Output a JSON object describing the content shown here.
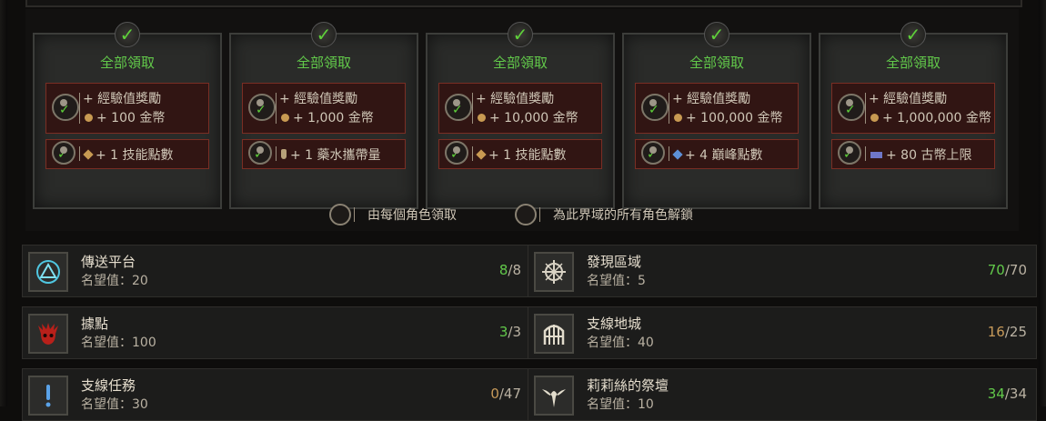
{
  "rewards": {
    "tiers": [
      {
        "claim": "全部領取",
        "line1": "+ 經驗值獎勵",
        "line2": "+ 100 金幣",
        "line3": "+ 1 技能點數",
        "line3_icon": "skill-point-icon"
      },
      {
        "claim": "全部領取",
        "line1": "+ 經驗值獎勵",
        "line2": "+ 1,000 金幣",
        "line3": "+ 1 藥水攜帶量",
        "line3_icon": "potion-icon"
      },
      {
        "claim": "全部領取",
        "line1": "+ 經驗值獎勵",
        "line2": "+ 10,000 金幣",
        "line3": "+ 1 技能點數",
        "line3_icon": "skill-point-icon"
      },
      {
        "claim": "全部領取",
        "line1": "+ 經驗值獎勵",
        "line2": "+ 100,000 金幣",
        "line3": "+ 4 巔峰點數",
        "line3_icon": "paragon-icon"
      },
      {
        "claim": "全部領取",
        "line1": "+ 經驗值獎勵",
        "line2": "+ 1,000,000 金幣",
        "line3": "+ 80 古幣上限",
        "line3_icon": "obol-icon"
      }
    ],
    "legend": {
      "per_character": "由每個角色領取",
      "all_characters": "為此界域的所有角色解鎖"
    }
  },
  "entries": {
    "waypoints": {
      "title": "傳送平台",
      "sub": "名望值：20",
      "done": "8",
      "total": "/8",
      "icon": "waypoint-icon"
    },
    "areas": {
      "title": "發現區域",
      "sub": "名望值：5",
      "done": "70",
      "total": "/70",
      "icon": "compass-icon"
    },
    "strongholds": {
      "title": "據點",
      "sub": "名望值：100",
      "done": "3",
      "total": "/3",
      "icon": "demon-skull-icon"
    },
    "dungeons": {
      "title": "支線地城",
      "sub": "名望值：40",
      "done": "16",
      "total": "/25",
      "icon": "gate-icon"
    },
    "side_quests": {
      "title": "支線任務",
      "sub": "名望值：30",
      "done": "0",
      "total": "/47",
      "icon": "exclamation-icon"
    },
    "altars": {
      "title": "莉莉絲的祭壇",
      "sub": "名望值：10",
      "done": "34",
      "total": "/34",
      "icon": "lilith-altar-icon"
    }
  },
  "colors": {
    "claimed": "#62c94a",
    "partial": "#c79a5a",
    "reward_box": "#311513"
  }
}
